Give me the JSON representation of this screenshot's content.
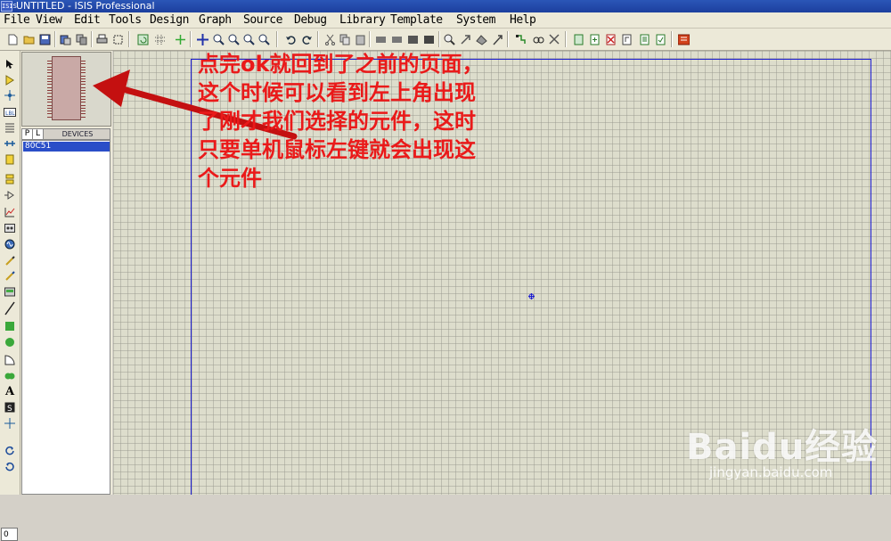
{
  "window": {
    "title": "UNTITLED - ISIS Professional",
    "app_icon_text": "ISIS"
  },
  "menu": [
    "File",
    "View",
    "Edit",
    "Tools",
    "Design",
    "Graph",
    "Source",
    "Debug",
    "Library",
    "Template",
    "System",
    "Help"
  ],
  "device_panel": {
    "tab_p": "P",
    "tab_l": "L",
    "header": "DEVICES",
    "items": [
      "80C51"
    ]
  },
  "zoom_field": "0",
  "annotation": {
    "lines": [
      "点完ok就回到了之前的页面，",
      "这个时候可以看到左上角出现",
      "了刚才我们选择的元件，这时",
      "只要单机鼠标左键就会出现这",
      "个元件"
    ],
    "color": "#ea1a1a"
  },
  "watermark": {
    "brand": "Baidu经验",
    "url": "jingyan.baidu.com"
  },
  "colors": {
    "canvas_bg": "#ddddcc",
    "sheet_border": "#1b1bd0",
    "selection": "#2a4ec8",
    "arrow": "#c41010"
  }
}
